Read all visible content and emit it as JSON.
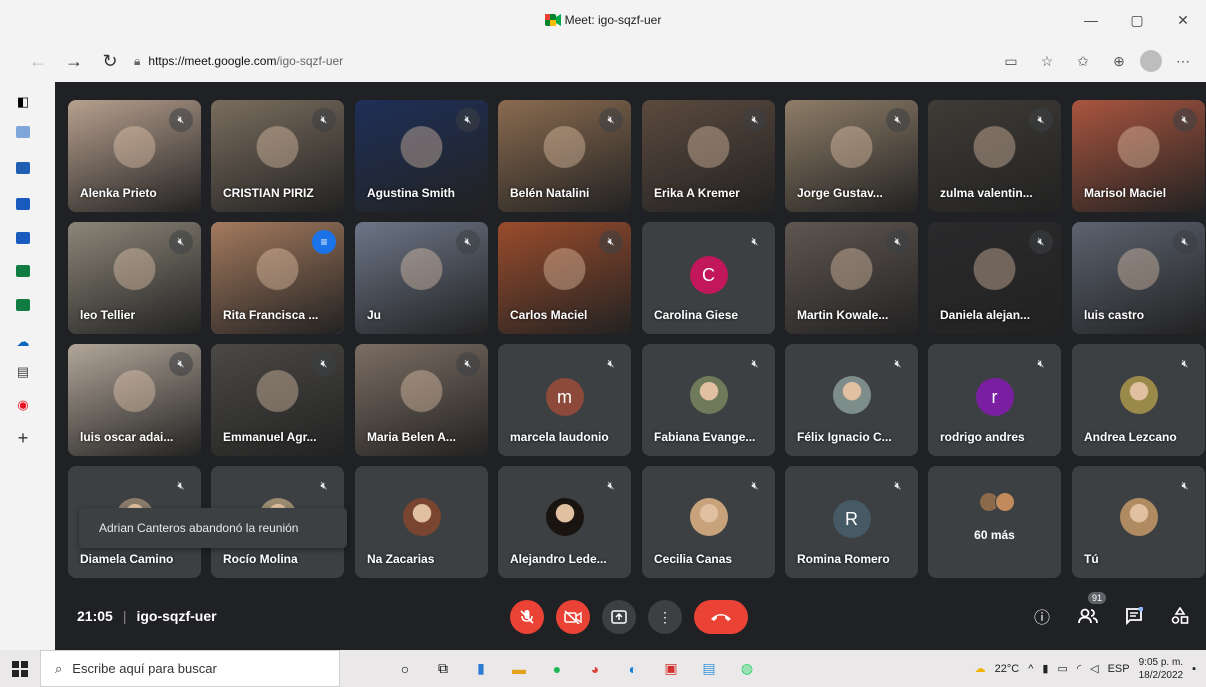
{
  "browser": {
    "tab_title": "Meet: igo-sqzf-uer",
    "url_host": "https://meet.google.com",
    "url_path": "/igo-sqzf-uer"
  },
  "meeting": {
    "time": "21:05",
    "code": "igo-sqzf-uer",
    "participants_count": "91",
    "toast": "Adrian Canteros abandonó la reunión",
    "more_label": "60 más"
  },
  "tiles": [
    {
      "name": "Alenka Prieto",
      "bg": "#b7a08e",
      "mic": "muted"
    },
    {
      "name": "CRISTIAN PIRIZ",
      "bg": "#7a6d5e",
      "mic": "muted"
    },
    {
      "name": "Agustina Smith",
      "bg": "#1e2f57",
      "mic": "muted"
    },
    {
      "name": "Belén Natalini",
      "bg": "#8a6b50",
      "mic": "muted"
    },
    {
      "name": "Erika A Kremer",
      "bg": "#5b4a3e",
      "mic": "muted"
    },
    {
      "name": "Jorge Gustav...",
      "bg": "#8e7d68",
      "mic": "muted"
    },
    {
      "name": "zulma valentin...",
      "bg": "#3f3b36",
      "mic": "muted"
    },
    {
      "name": "Marisol Maciel",
      "bg": "#a9553f",
      "mic": "muted"
    },
    {
      "name": "leo Tellier",
      "bg": "#8c8678",
      "mic": "muted"
    },
    {
      "name": "Rita Francisca ...",
      "bg": "#a47a5e",
      "mic": "speaking"
    },
    {
      "name": "Ju",
      "bg": "#6d7688",
      "mic": "muted"
    },
    {
      "name": "Carlos Maciel",
      "bg": "#9a4c2c",
      "mic": "muted"
    },
    {
      "name": "Carolina Giese",
      "letter": "C",
      "letter_bg": "#c2185b",
      "mic": "muted"
    },
    {
      "name": "Martin Kowale...",
      "bg": "#5f5650",
      "mic": "muted"
    },
    {
      "name": "Daniela alejan...",
      "bg": "#2a2a2c",
      "mic": "muted"
    },
    {
      "name": "luis castro",
      "bg": "#5c6370",
      "mic": "muted"
    },
    {
      "name": "luis oscar adai...",
      "bg": "#b2a699",
      "mic": "muted"
    },
    {
      "name": "Emmanuel Agr...",
      "bg": "#4b4945",
      "mic": "muted"
    },
    {
      "name": "Maria Belen A...",
      "bg": "#7c6e63",
      "mic": "muted"
    },
    {
      "name": "marcela laudonio",
      "letter": "m",
      "letter_bg": "#8d4a3a",
      "mic": "muted"
    },
    {
      "name": "Fabiana Evange...",
      "avatar": "#6f7a5a",
      "mic": "muted"
    },
    {
      "name": "Félix Ignacio C...",
      "avatar": "#7d8d8a",
      "mic": "muted"
    },
    {
      "name": "rodrigo andres",
      "letter": "r",
      "letter_bg": "#7b1fa2",
      "mic": "muted"
    },
    {
      "name": "Andrea Lezcano",
      "avatar": "#9a8a4a",
      "mic": "muted"
    },
    {
      "name": "Diamela Camino",
      "avatar": "#8a7a6a",
      "mic": "muted"
    },
    {
      "name": "Rocío Molina",
      "avatar": "#9a8a70",
      "mic": "muted"
    },
    {
      "name": "Na Zacarias",
      "avatar": "#7a4530",
      "mic": "none"
    },
    {
      "name": "Alejandro Lede...",
      "avatar": "#1a1410",
      "mic": "muted"
    },
    {
      "name": "Cecilia Canas",
      "avatar": "#c7a27a",
      "mic": "muted"
    },
    {
      "name": "Romina Romero",
      "letter": "R",
      "letter_bg": "#455a64",
      "mic": "muted"
    },
    {
      "more": true,
      "mic": "none"
    },
    {
      "name": "Tú",
      "avatar": "#b08a60",
      "mic": "muted"
    }
  ],
  "taskbar": {
    "search_placeholder": "Escribe aquí para buscar",
    "temperature": "22°C",
    "lang": "ESP",
    "time": "9:05 p. m.",
    "date": "18/2/2022"
  }
}
